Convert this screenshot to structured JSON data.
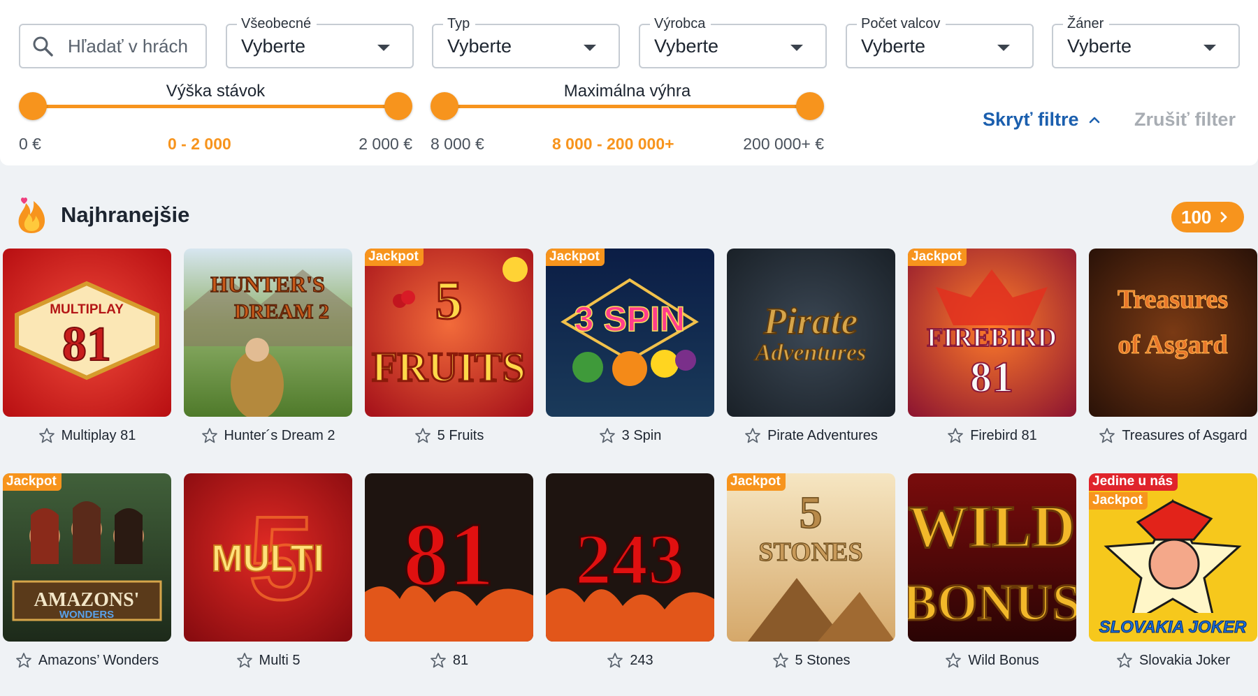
{
  "filters": {
    "search": {
      "placeholder": "Hľadať v hrách",
      "icon": "search-icon"
    },
    "selects": [
      {
        "label": "Všeobecné",
        "value": "Vyberte"
      },
      {
        "label": "Typ",
        "value": "Vyberte"
      },
      {
        "label": "Výrobca",
        "value": "Vyberte"
      },
      {
        "label": "Počet valcov",
        "value": "Vyberte"
      },
      {
        "label": "Žáner",
        "value": "Vyberte"
      }
    ],
    "stake_range": {
      "title": "Výška stávok",
      "min_label": "0 €",
      "value_label": "0 - 2 000",
      "max_label": "2 000 €",
      "selected_fraction": [
        0,
        1
      ]
    },
    "win_range": {
      "title": "Maximálna výhra",
      "min_label": "8 000 €",
      "value_label": "8 000 - 200 000+",
      "max_label": "200 000+ €",
      "selected_fraction": [
        0,
        1
      ]
    },
    "hide_filters_label": "Skryť filtre",
    "clear_filter_label": "Zrušiť filter"
  },
  "section": {
    "title": "Najhranejšie",
    "icon": "fire-icon",
    "count_label": "100"
  },
  "badges": {
    "jackpot": "Jackpot",
    "exclusive": "Jedine u nás"
  },
  "games": [
    {
      "name": "Multiplay 81",
      "jackpot": false,
      "art_text": "81",
      "art_sub": "MULTIPLAY"
    },
    {
      "name": "Hunter´s Dream 2",
      "jackpot": false,
      "art_text": "HUNTER'S",
      "art_sub": "DREAM 2"
    },
    {
      "name": "5 Fruits",
      "jackpot": true,
      "art_text": "5",
      "art_sub": "FRUITS"
    },
    {
      "name": "3 Spin",
      "jackpot": true,
      "art_text": "3 SPIN",
      "art_sub": ""
    },
    {
      "name": "Pirate Adventures",
      "jackpot": false,
      "art_text": "Pirate",
      "art_sub": "Adventures"
    },
    {
      "name": "Firebird 81",
      "jackpot": true,
      "art_text": "FIREBIRD",
      "art_sub": "81"
    },
    {
      "name": "Treasures of Asgard",
      "jackpot": false,
      "art_text": "Treasures",
      "art_sub": "of Asgard"
    },
    {
      "name": "Amazons’ Wonders",
      "jackpot": true,
      "art_text": "AMAZONS'",
      "art_sub": "WONDERS"
    },
    {
      "name": "Multi 5",
      "jackpot": false,
      "art_text": "MULTI",
      "art_sub": "5"
    },
    {
      "name": "81",
      "jackpot": false,
      "art_text": "81",
      "art_sub": ""
    },
    {
      "name": "243",
      "jackpot": false,
      "art_text": "243",
      "art_sub": ""
    },
    {
      "name": "5 Stones",
      "jackpot": true,
      "art_text": "5",
      "art_sub": "STONES"
    },
    {
      "name": "Wild Bonus",
      "jackpot": false,
      "art_text": "WILD",
      "art_sub": "BONUS"
    },
    {
      "name": "Slovakia Joker",
      "jackpot": true,
      "exclusive": true,
      "art_text": "SLOVAKIA JOKER",
      "art_sub": ""
    }
  ],
  "colors": {
    "accent": "#f7941d",
    "link": "#1b5fae",
    "exclusive": "#e0242b"
  }
}
